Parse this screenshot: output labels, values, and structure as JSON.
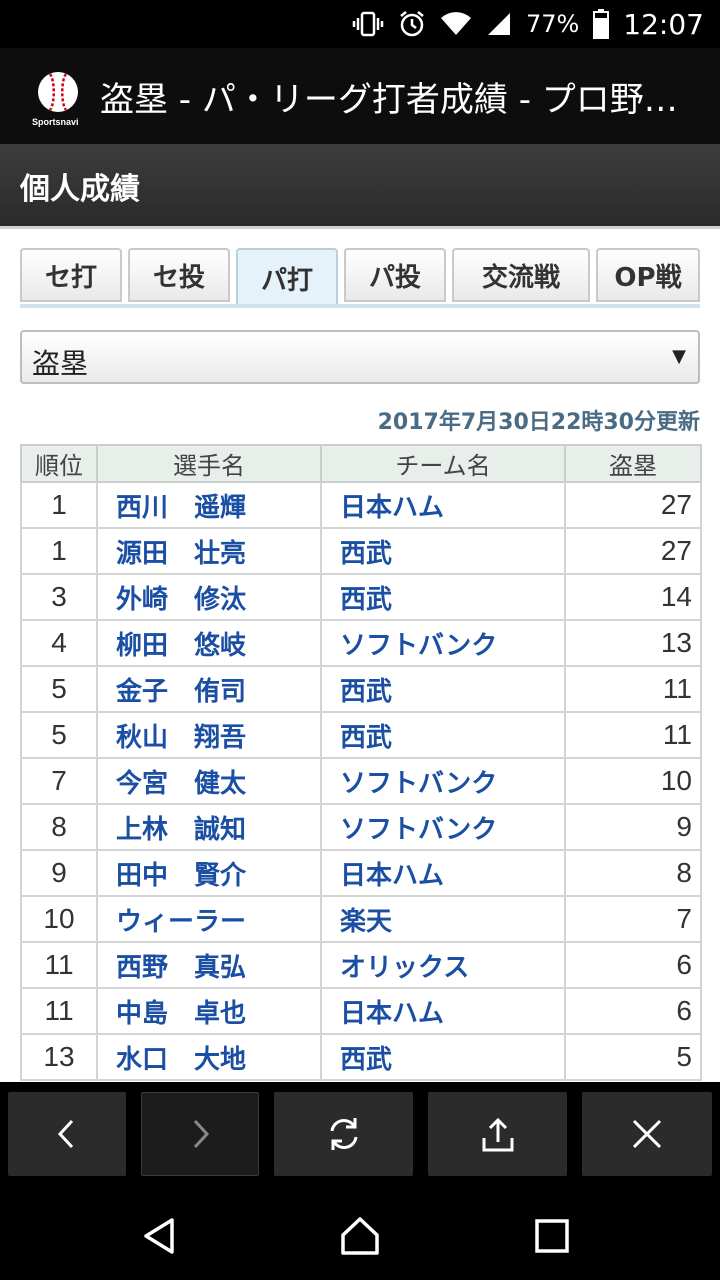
{
  "status_bar": {
    "battery": "77%",
    "time": "12:07",
    "icons": [
      "vibrate-icon",
      "alarm-icon",
      "wifi-icon",
      "signal-icon",
      "battery-icon"
    ]
  },
  "app_bar": {
    "logo_text": "Sportsnavi",
    "title": "盗塁 - パ・リーグ打者成績 - プロ野球 - スポーツナビ"
  },
  "section": {
    "title": "個人成績"
  },
  "tabs": [
    {
      "label": "セ打",
      "active": false
    },
    {
      "label": "セ投",
      "active": false
    },
    {
      "label": "パ打",
      "active": true
    },
    {
      "label": "パ投",
      "active": false
    },
    {
      "label": "交流戦",
      "active": false
    },
    {
      "label": "OP戦",
      "active": false
    }
  ],
  "category_select": {
    "value": "盗塁"
  },
  "updated": "2017年7月30日22時30分更新",
  "table": {
    "headers": [
      "順位",
      "選手名",
      "チーム名",
      "盗塁"
    ],
    "rows": [
      {
        "rank": "1",
        "name": "西川　遥輝",
        "team": "日本ハム",
        "value": "27"
      },
      {
        "rank": "1",
        "name": "源田　壮亮",
        "team": "西武",
        "value": "27"
      },
      {
        "rank": "3",
        "name": "外崎　修汰",
        "team": "西武",
        "value": "14"
      },
      {
        "rank": "4",
        "name": "柳田　悠岐",
        "team": "ソフトバンク",
        "value": "13"
      },
      {
        "rank": "5",
        "name": "金子　侑司",
        "team": "西武",
        "value": "11"
      },
      {
        "rank": "5",
        "name": "秋山　翔吾",
        "team": "西武",
        "value": "11"
      },
      {
        "rank": "7",
        "name": "今宮　健太",
        "team": "ソフトバンク",
        "value": "10"
      },
      {
        "rank": "8",
        "name": "上林　誠知",
        "team": "ソフトバンク",
        "value": "9"
      },
      {
        "rank": "9",
        "name": "田中　賢介",
        "team": "日本ハム",
        "value": "8"
      },
      {
        "rank": "10",
        "name": "ウィーラー",
        "team": "楽天",
        "value": "7"
      },
      {
        "rank": "11",
        "name": "西野　真弘",
        "team": "オリックス",
        "value": "6"
      },
      {
        "rank": "11",
        "name": "中島　卓也",
        "team": "日本ハム",
        "value": "6"
      },
      {
        "rank": "13",
        "name": "水口　大地",
        "team": "西武",
        "value": "5"
      }
    ]
  },
  "browser_toolbar": [
    "back-icon",
    "forward-icon",
    "reload-icon",
    "share-icon",
    "close-icon"
  ],
  "nav_bar": [
    "back-icon",
    "home-icon",
    "recents-icon"
  ]
}
